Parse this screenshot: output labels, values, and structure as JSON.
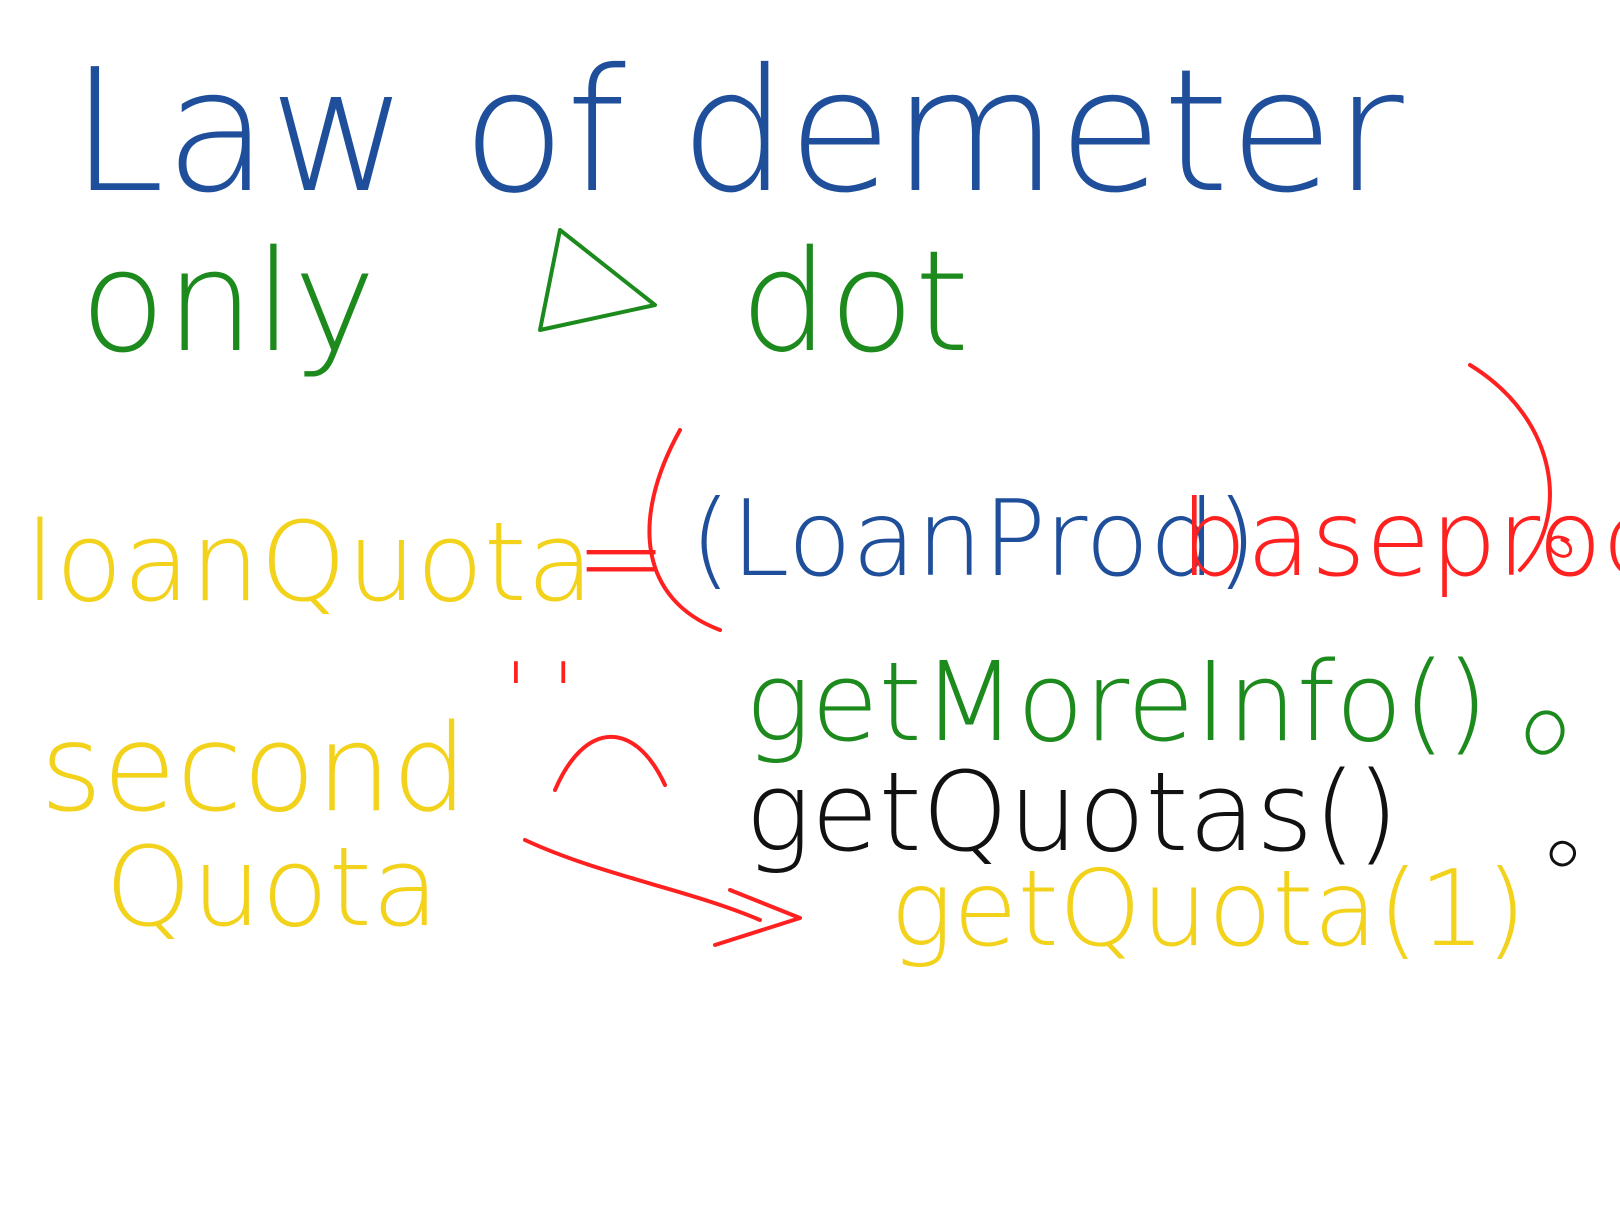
{
  "whiteboard": {
    "title": "Law of demeter",
    "rule": {
      "prefix": "only",
      "triangle_hint": "1",
      "suffix": "dot"
    },
    "code_line": {
      "lhs": "loanQuota",
      "equals": "=",
      "cast": "(LoanProd)",
      "target": "baseprod",
      "call1": "getMoreInfo()",
      "call2": "getQuotas()",
      "call3": "getQuota(1)"
    },
    "sad_face": {
      "eyes": "' '"
    },
    "note": {
      "line1": "second",
      "line2": "Quota"
    },
    "colors": {
      "blue": "#1f4f9a",
      "green": "#1c8a1c",
      "yellow": "#f2d21b",
      "red": "#ff2020",
      "black": "#111111"
    }
  }
}
